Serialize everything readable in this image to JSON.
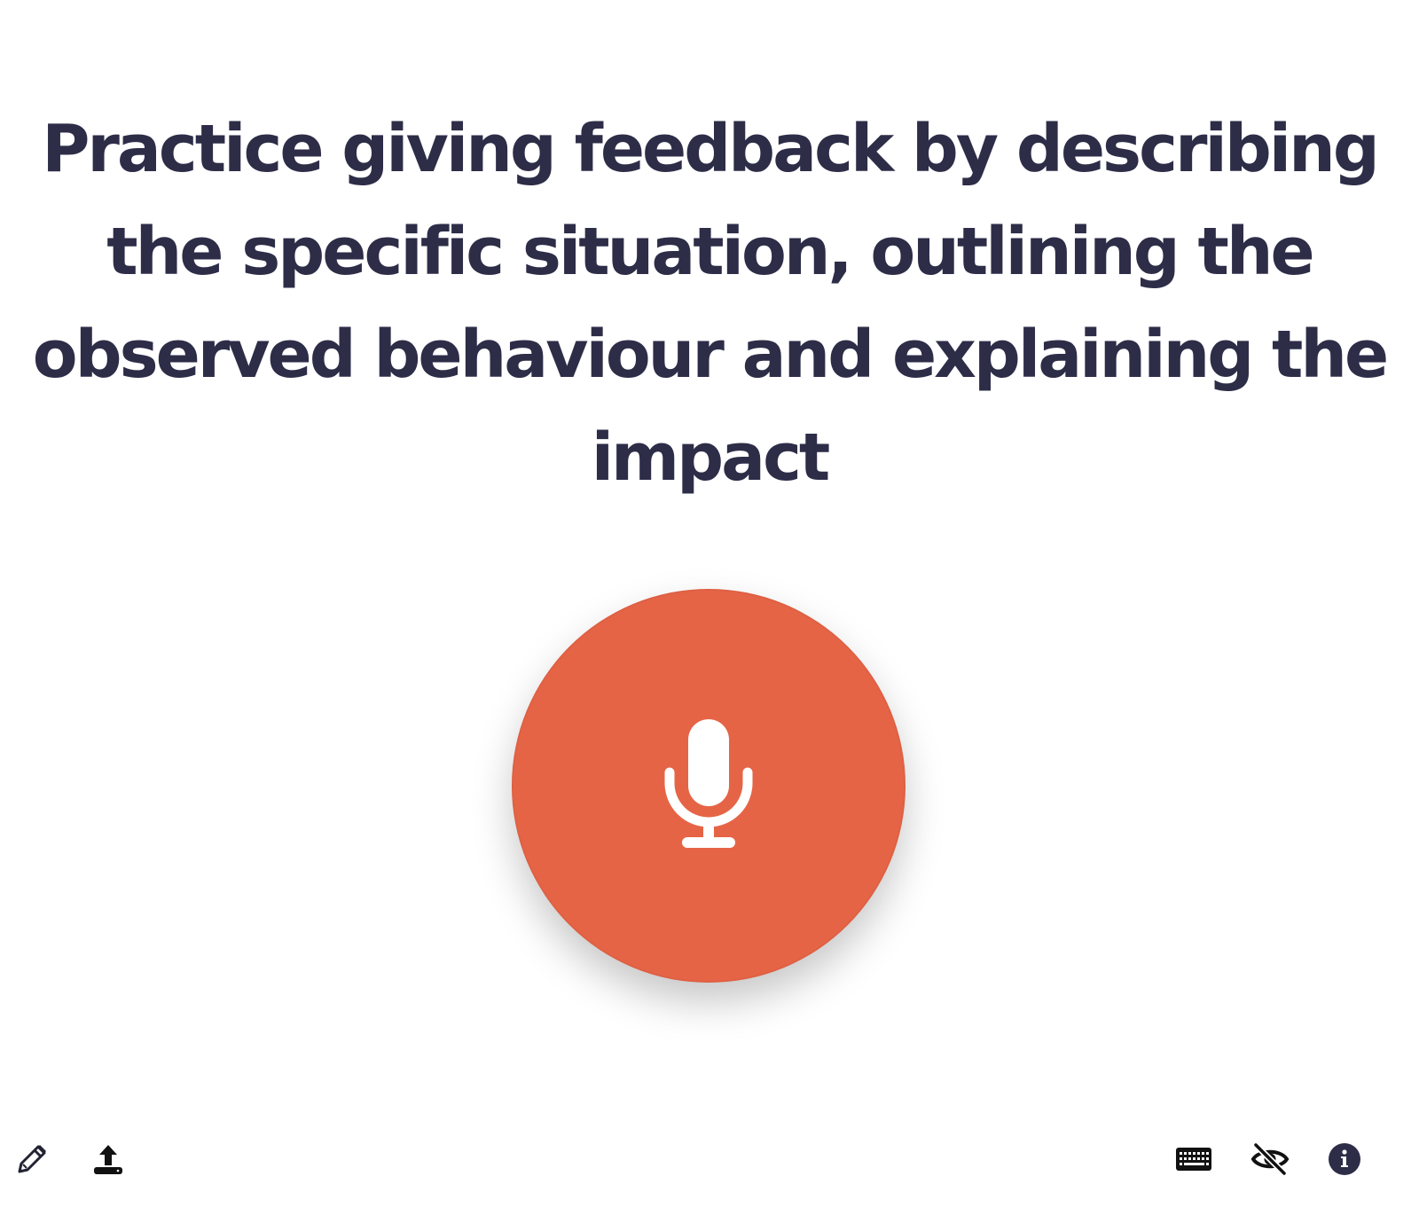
{
  "prompt": {
    "text": "Practice giving feedback by describing the specific situation, outlining the observed behaviour and explaining the impact"
  },
  "record_button": {
    "icon": "microphone-icon",
    "color": "#e66446"
  },
  "toolbar": {
    "left": [
      {
        "icon": "pencil-icon"
      },
      {
        "icon": "upload-icon"
      }
    ],
    "right": [
      {
        "icon": "keyboard-icon"
      },
      {
        "icon": "eye-slash-icon"
      },
      {
        "icon": "info-icon"
      }
    ]
  },
  "colors": {
    "text": "#2d2d48",
    "accent": "#e66446",
    "icon": "#111111",
    "background": "#ffffff"
  }
}
